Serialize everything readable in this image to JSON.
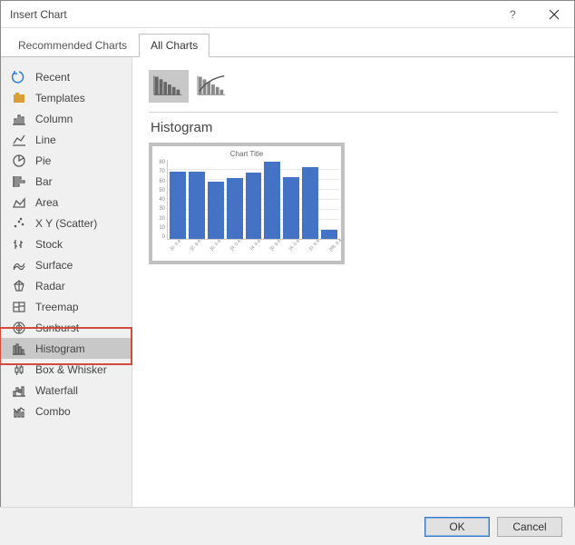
{
  "window": {
    "title": "Insert Chart"
  },
  "tabs": {
    "recommended": "Recommended Charts",
    "all": "All Charts"
  },
  "sidebar": {
    "items": [
      {
        "label": "Recent"
      },
      {
        "label": "Templates"
      },
      {
        "label": "Column"
      },
      {
        "label": "Line"
      },
      {
        "label": "Pie"
      },
      {
        "label": "Bar"
      },
      {
        "label": "Area"
      },
      {
        "label": "X Y (Scatter)"
      },
      {
        "label": "Stock"
      },
      {
        "label": "Surface"
      },
      {
        "label": "Radar"
      },
      {
        "label": "Treemap"
      },
      {
        "label": "Sunburst"
      },
      {
        "label": "Histogram"
      },
      {
        "label": "Box & Whisker"
      },
      {
        "label": "Waterfall"
      },
      {
        "label": "Combo"
      }
    ]
  },
  "content": {
    "section_title": "Histogram",
    "preview_title": "Chart Title"
  },
  "chart_data": {
    "type": "bar",
    "categories": [
      "[0, 0.4…",
      "[2, 0.4…",
      "[0, 0.4…",
      "[4, 0.4…",
      "[4, 0.4…",
      "[0, 0.4…",
      "[4, 0.4…",
      "[0, 0.4…",
      "[88, 0.4…"
    ],
    "values": [
      68,
      68,
      58,
      62,
      67,
      78,
      63,
      73,
      9
    ],
    "title": "Chart Title",
    "ylim": [
      0,
      80
    ],
    "yticks": [
      80,
      70,
      60,
      50,
      40,
      30,
      20,
      10,
      0
    ]
  },
  "footer": {
    "ok": "OK",
    "cancel": "Cancel"
  }
}
